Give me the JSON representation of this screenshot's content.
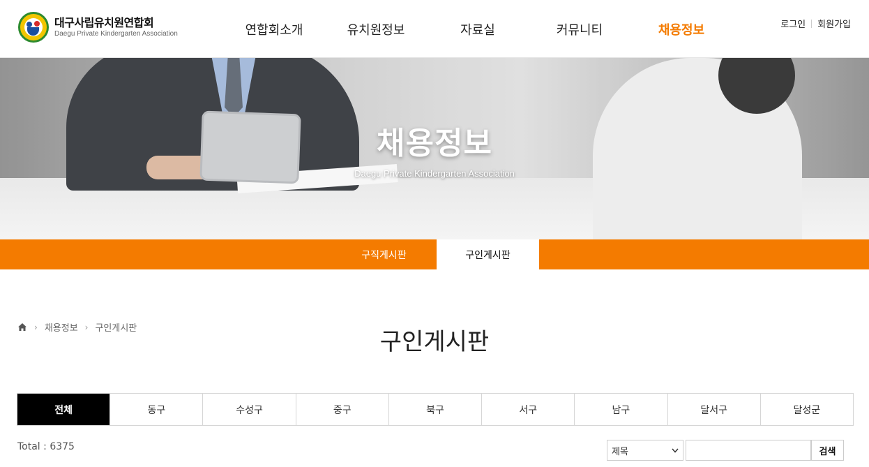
{
  "header": {
    "logo_kr": "대구사립유치원연합회",
    "logo_en": "Daegu Private Kindergarten Association",
    "nav": [
      "연합회소개",
      "유치원정보",
      "자료실",
      "커뮤니티",
      "채용정보"
    ],
    "active_nav_index": 4,
    "login": "로그인",
    "signup": "회원가입"
  },
  "hero": {
    "title": "채용정보",
    "subtitle": "Daegu Private Kindergarten Association"
  },
  "subnav": {
    "items": [
      "구직게시판",
      "구인게시판"
    ],
    "active_index": 1
  },
  "breadcrumb": {
    "items": [
      "채용정보",
      "구인게시판"
    ]
  },
  "page_title": "구인게시판",
  "regions": {
    "tabs": [
      "전체",
      "동구",
      "수성구",
      "중구",
      "북구",
      "서구",
      "남구",
      "달서구",
      "달성군"
    ],
    "active_index": 0
  },
  "total": {
    "label": "Total : 6375"
  },
  "search": {
    "select_value": "제목",
    "button": "검색"
  },
  "colors": {
    "accent": "#f47b00",
    "active_tab_bg": "#000000"
  }
}
